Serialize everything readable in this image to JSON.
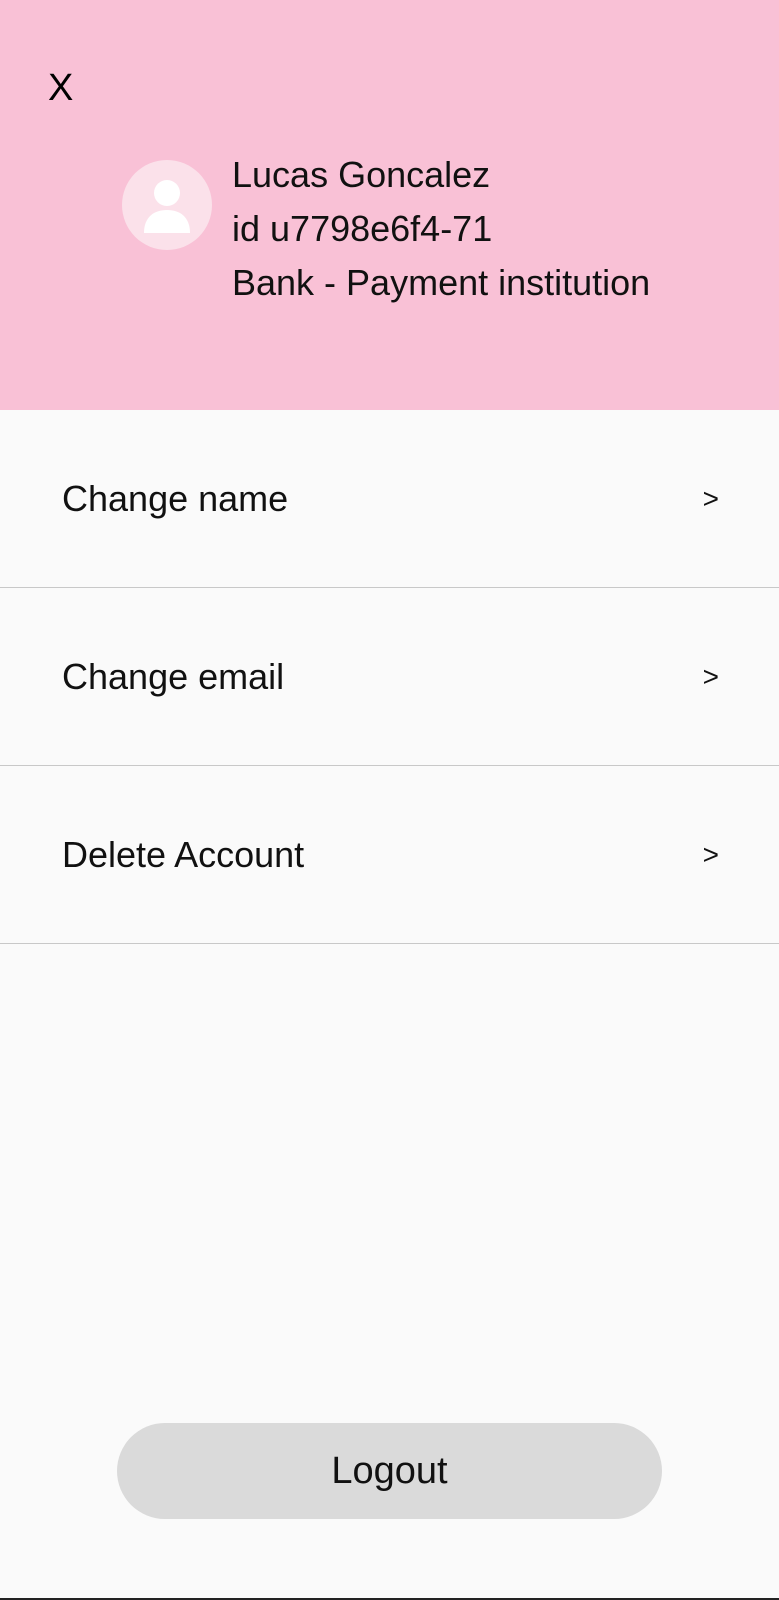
{
  "header": {
    "close_label": "X",
    "profile": {
      "avatar_icon": "person-icon",
      "name": "Lucas Goncalez",
      "id_line": "id u7798e6f4-71",
      "institution": "Bank - Payment institution"
    },
    "background_color": "#f9c1d6"
  },
  "menu": {
    "items": [
      {
        "label": "Change name",
        "chevron": ">"
      },
      {
        "label": "Change email",
        "chevron": ">"
      },
      {
        "label": "Delete Account",
        "chevron": ">"
      }
    ]
  },
  "footer": {
    "logout_label": "Logout"
  }
}
